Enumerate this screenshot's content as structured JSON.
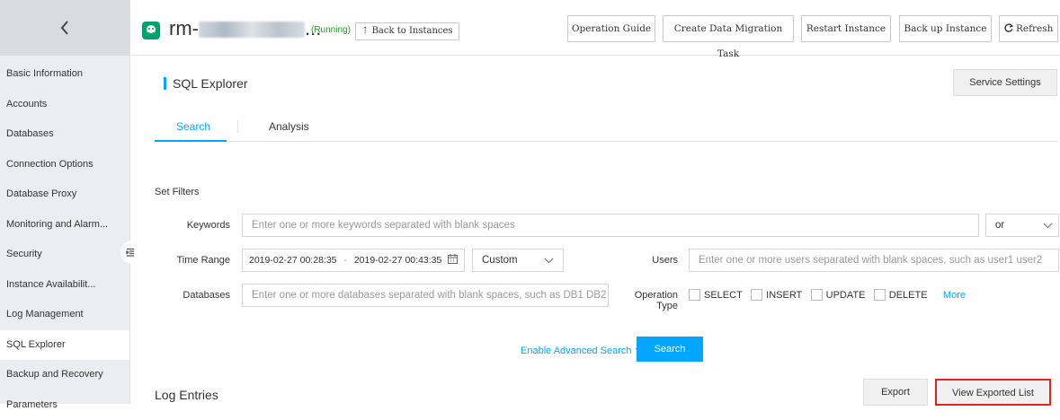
{
  "sidebar": {
    "items": [
      {
        "label": "Basic Information"
      },
      {
        "label": "Accounts"
      },
      {
        "label": "Databases"
      },
      {
        "label": "Connection Options"
      },
      {
        "label": "Database Proxy"
      },
      {
        "label": "Monitoring and Alarm..."
      },
      {
        "label": "Security"
      },
      {
        "label": "Instance Availabilit..."
      },
      {
        "label": "Log Management"
      },
      {
        "label": "SQL Explorer"
      },
      {
        "label": "Backup and Recovery"
      },
      {
        "label": "Parameters"
      }
    ],
    "active": "SQL Explorer"
  },
  "header": {
    "instance_prefix": "rm-",
    "instance_suffix": "...",
    "status": "(Running)",
    "back_button": "Back to Instances",
    "back_button_glyph": "⇡",
    "buttons": {
      "operation_guide": "Operation Guide",
      "create_migration": "Create Data Migration Task",
      "restart": "Restart Instance",
      "backup": "Back up Instance",
      "refresh": "Refresh"
    }
  },
  "page": {
    "title": "SQL Explorer",
    "service_settings": "Service Settings",
    "tabs": [
      {
        "label": "Search"
      },
      {
        "label": "Analysis"
      }
    ],
    "active_tab": "Search"
  },
  "filters": {
    "heading": "Set Filters",
    "keywords_label": "Keywords",
    "keywords_placeholder": "Enter one or more keywords separated with blank spaces",
    "logic_value": "or",
    "time_range_label": "Time Range",
    "time_start": "2019-02-27 00:28:35",
    "time_sep": "-",
    "time_end": "2019-02-27 00:43:35",
    "range_mode": "Custom",
    "users_label": "Users",
    "users_placeholder": "Enter one or more users separated with blank spaces, such as user1 user2",
    "databases_label": "Databases",
    "databases_placeholder": "Enter one or more databases separated with blank spaces, such as DB1 DB2",
    "operation_type_label": "Operation Type",
    "operation_types": [
      {
        "label": "SELECT"
      },
      {
        "label": "INSERT"
      },
      {
        "label": "UPDATE"
      },
      {
        "label": "DELETE"
      }
    ],
    "more_link": "More",
    "advanced_search": "Enable Advanced Search",
    "search_button": "Search"
  },
  "log": {
    "title": "Log Entries",
    "export": "Export",
    "view_exported": "View Exported List"
  },
  "colors": {
    "accent": "#00a6ff",
    "running": "#1e9e1e",
    "highlight": "#e0241f",
    "brand": "#00a36c"
  }
}
